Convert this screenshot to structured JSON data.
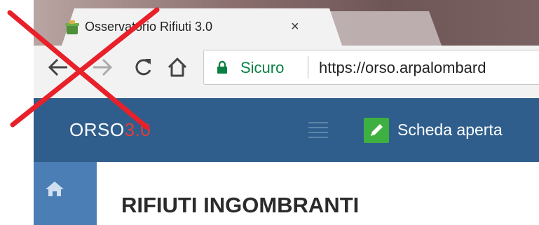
{
  "browser": {
    "tab": {
      "title": "Osservatorio Rifiuti 3.0",
      "close_glyph": "×",
      "favicon": "recycle-bin-icon"
    },
    "toolbar": {
      "back_icon": "back-arrow-icon",
      "forward_icon": "forward-arrow-icon",
      "reload_icon": "reload-icon",
      "home_icon": "home-icon"
    },
    "omnibox": {
      "secure_label": "Sicuro",
      "url": "https://orso.arpalombard"
    }
  },
  "app": {
    "brand_name": "ORSO",
    "brand_version": "3.0",
    "menu_toggle_icon": "hamburger-menu-icon",
    "status": {
      "label": "Scheda aperta",
      "icon": "pencil-icon"
    },
    "side_nav_home_icon": "home-icon",
    "page_title": "RIFIUTI INGOMBRANTI"
  },
  "annotation": {
    "strike_icon": "red-x-mark",
    "color": "#e8202a"
  },
  "colors": {
    "header_bg": "#2f5e8c",
    "side_nav_bg": "#4a7eb4",
    "brand_accent": "#e33b3b",
    "status_green": "#3eb041",
    "secure_green": "#0b8043"
  }
}
